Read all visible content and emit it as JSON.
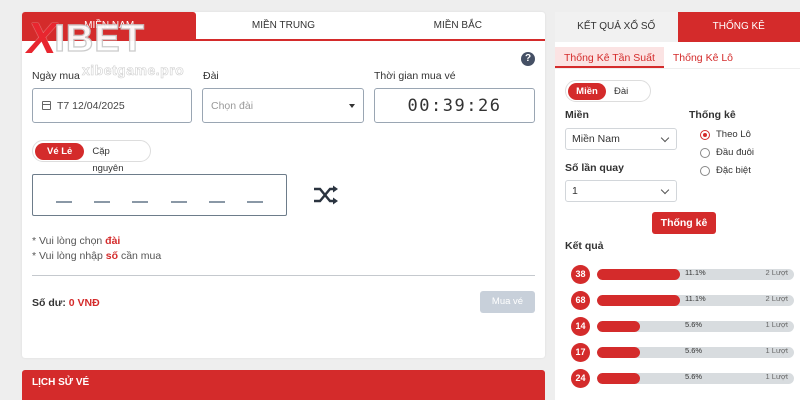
{
  "colors": {
    "accent": "#d42b2b",
    "page_bg": "#eeeeee",
    "panel_bg": "#ffffff",
    "disabled_btn": "#c8d0da"
  },
  "logo": {
    "brand_x": "X",
    "brand_rest": "IBET",
    "watermark": "xibetgame.pro"
  },
  "region_tabs": [
    {
      "label": "MIỀN NAM",
      "active": true
    },
    {
      "label": "MIỀN TRUNG",
      "active": false
    },
    {
      "label": "MIỀN BẮC",
      "active": false
    }
  ],
  "help_icon": {
    "symbol": "?",
    "icon": "question-circle-icon"
  },
  "form": {
    "date_label": "Ngày mua",
    "date_value": "T7 12/04/2025",
    "dai_label": "Đài",
    "dai_placeholder": "Chọn đài",
    "time_label": "Thời gian mua vé",
    "time_value": "00:39:26"
  },
  "ticket_type": {
    "options": [
      "Vé Lẻ",
      "Cặp nguyên"
    ],
    "selected": "Vé Lẻ"
  },
  "number_slots": 6,
  "notes": [
    {
      "prefix": "* Vui lòng chọn ",
      "highlight": "đài",
      "suffix": ""
    },
    {
      "prefix": "* Vui lòng nhập ",
      "highlight": "số",
      "suffix": " cần mua"
    }
  ],
  "balance": {
    "label": "Số dư:",
    "value": "0 VNĐ"
  },
  "buy_button": "Mua vé",
  "history_title": "LỊCH SỬ VÉ",
  "right_panel": {
    "tabs": [
      {
        "label": "KẾT QUẢ XỔ SỐ",
        "active": false
      },
      {
        "label": "THỐNG KÊ",
        "active": true
      }
    ],
    "sub_tabs": [
      {
        "label": "Thống Kê Tần Suất",
        "active": true
      },
      {
        "label": "Thống Kê Lô",
        "active": false
      }
    ],
    "region_toggle": {
      "options": [
        "Miền",
        "Đài"
      ],
      "selected": "Miền"
    },
    "mien_label": "Miền",
    "mien_value": "Miền Nam",
    "quay_label": "Số lần quay",
    "quay_value": "1",
    "stat_label": "Thống kê",
    "stat_options": [
      {
        "label": "Theo Lô",
        "checked": true
      },
      {
        "label": "Đầu đuôi",
        "checked": false
      },
      {
        "label": "Đặc biệt",
        "checked": false
      }
    ],
    "submit_label": "Thống kê",
    "results_label": "Kết quả",
    "results": [
      {
        "number": "38",
        "percent": "11.1%",
        "count": "2 Lượt",
        "fill": 0.42
      },
      {
        "number": "68",
        "percent": "11.1%",
        "count": "2 Lượt",
        "fill": 0.42
      },
      {
        "number": "14",
        "percent": "5.6%",
        "count": "1 Lượt",
        "fill": 0.22
      },
      {
        "number": "17",
        "percent": "5.6%",
        "count": "1 Lượt",
        "fill": 0.22
      },
      {
        "number": "24",
        "percent": "5.6%",
        "count": "1 Lượt",
        "fill": 0.22
      }
    ]
  }
}
